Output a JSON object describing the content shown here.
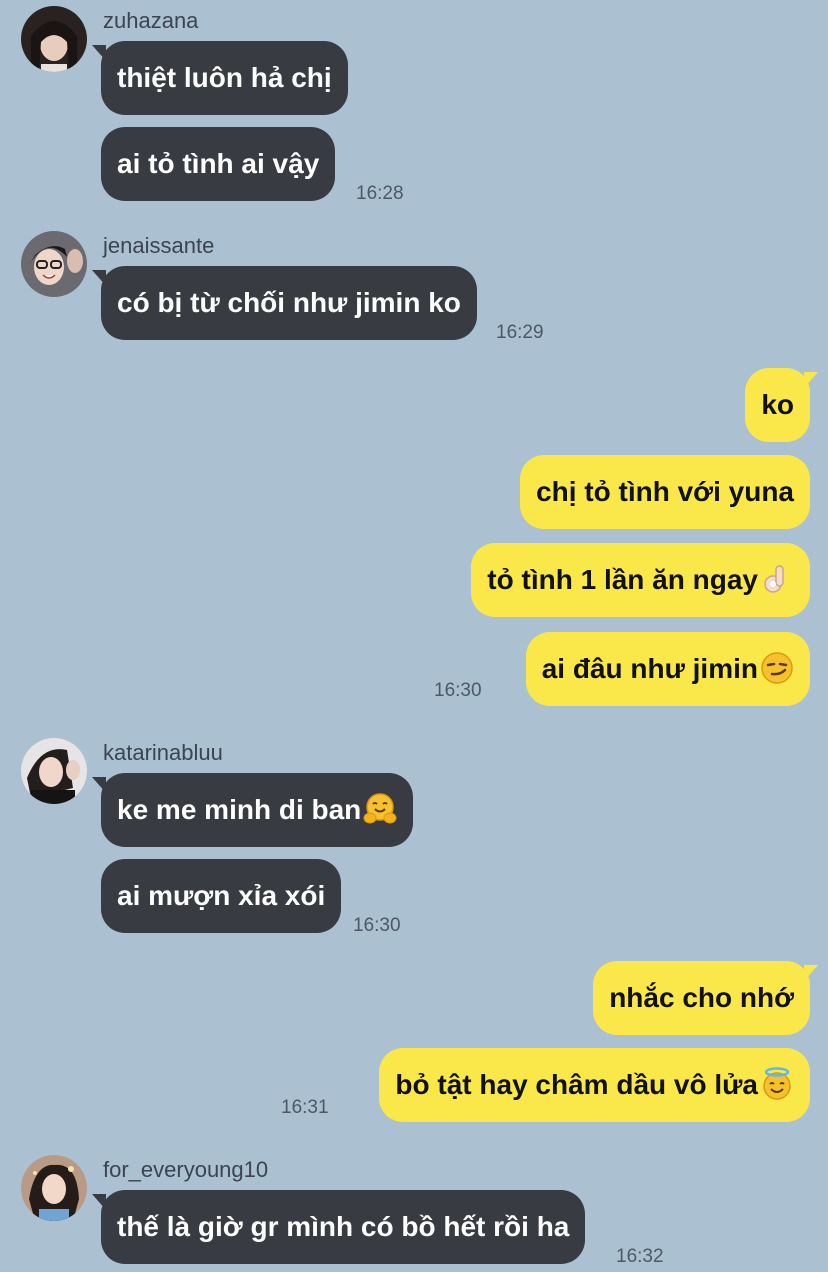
{
  "messages": [
    {
      "sender": "zuhazana",
      "avatar_icon": "profile-photo-zuhazana-icon",
      "bubbles": [
        "thiệt luôn hả chị",
        "ai tỏ tình ai vậy"
      ],
      "time": "16:28"
    },
    {
      "sender": "jenaissante",
      "avatar_icon": "profile-photo-jenaissante-icon",
      "bubbles": [
        "có bị từ chối như jimin ko"
      ],
      "time": "16:29"
    },
    {
      "sender": "me",
      "bubbles": [
        "ko",
        "chị tỏ tình với yuna",
        "tỏ tình 1 lần ăn ngay",
        "ai đâu như jimin"
      ],
      "emojis": {
        "2": "ok-hand-emoji-icon",
        "3": "smirk-emoji-icon"
      },
      "time": "16:30"
    },
    {
      "sender": "katarinabluu",
      "avatar_icon": "profile-photo-katarinabluu-icon",
      "bubbles": [
        "ke me minh di ban",
        "ai mượn xỉa xói"
      ],
      "emojis": {
        "0": "hugging-face-emoji-icon"
      },
      "time": "16:30"
    },
    {
      "sender": "me",
      "bubbles": [
        "nhắc cho nhớ",
        "bỏ tật hay châm dầu vô lửa"
      ],
      "emojis": {
        "1": "halo-smile-emoji-icon"
      },
      "time": "16:31"
    },
    {
      "sender": "for_everyoung10",
      "avatar_icon": "profile-photo-for-everyoung10-icon",
      "bubbles": [
        "thế là giờ gr mình có bồ hết rồi ha"
      ],
      "time": "16:32"
    }
  ],
  "colors": {
    "background": "#abc1d1",
    "incoming_bubble": "#383b42",
    "outgoing_bubble": "#fae84b"
  }
}
